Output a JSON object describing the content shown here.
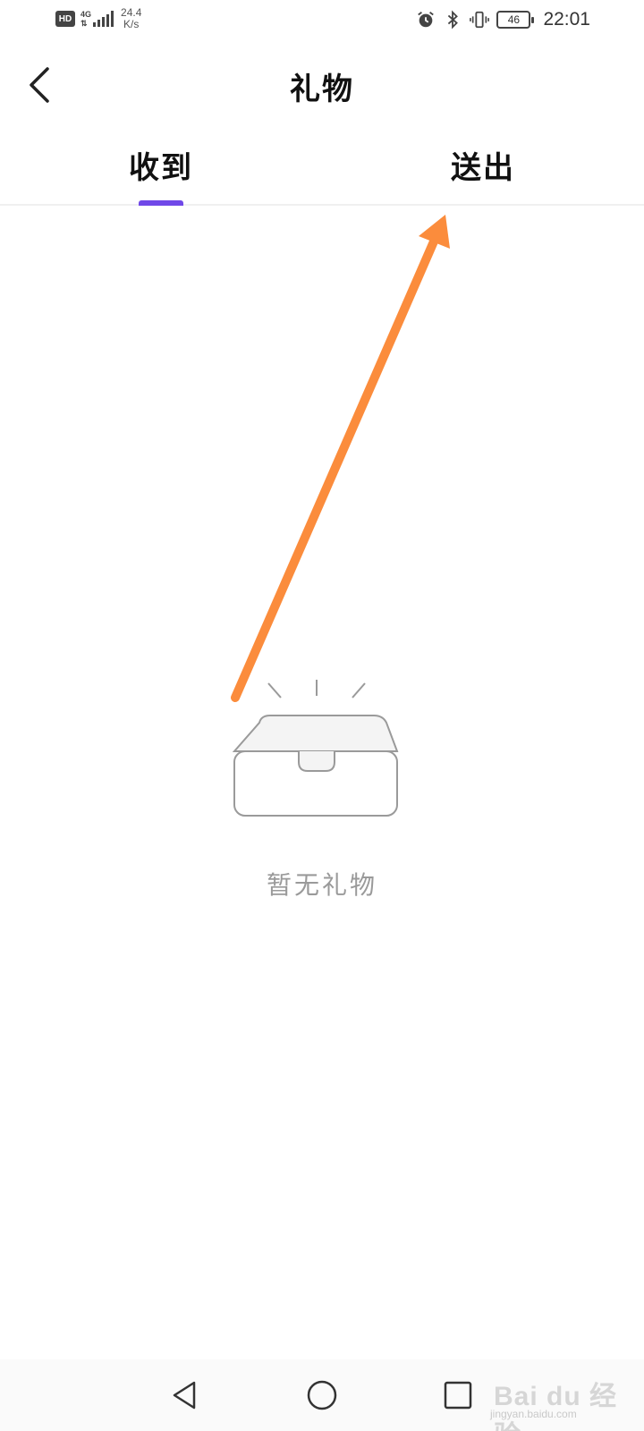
{
  "status_bar": {
    "hd_badge": "HD",
    "network_type": "4G",
    "speed_value": "24.4",
    "speed_unit": "K/s",
    "battery_level": "46",
    "time": "22:01"
  },
  "header": {
    "title": "礼物"
  },
  "tabs": [
    {
      "label": "收到",
      "active": true
    },
    {
      "label": "送出",
      "active": false
    }
  ],
  "accent_color": "#7048e8",
  "annotation_color": "#fb8c3c",
  "empty_state": {
    "icon": "empty-box-icon",
    "message": "暂无礼物"
  },
  "nav_bar": {
    "icons": [
      "nav-back-icon",
      "nav-home-icon",
      "nav-recent-apps-icon"
    ]
  },
  "watermark": {
    "brand": "Bai du 经验",
    "site": "jingyan.baidu.com"
  }
}
